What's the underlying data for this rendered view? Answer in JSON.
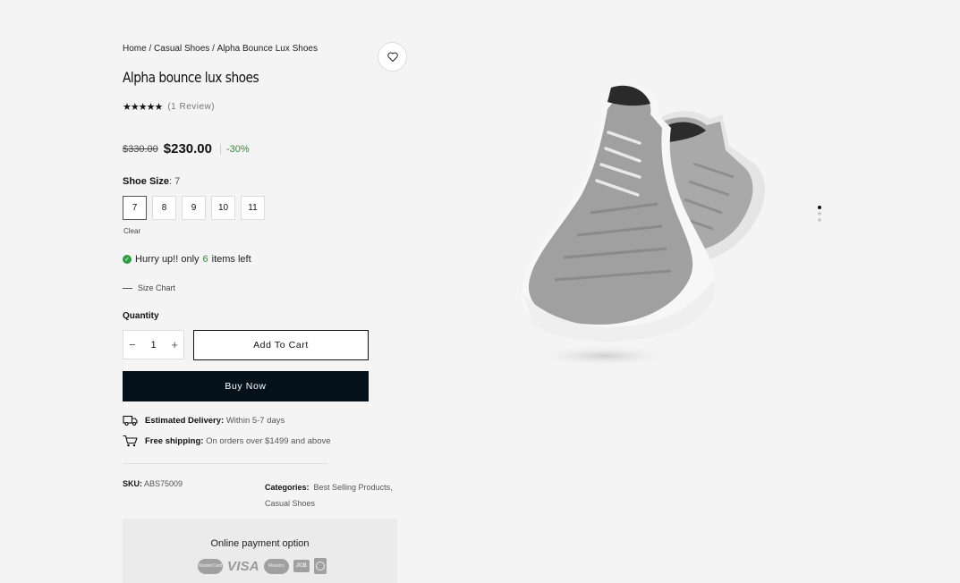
{
  "breadcrumb": {
    "home": "Home",
    "sep1": " / ",
    "category": "Casual Shoes",
    "sep2": " / ",
    "current": "Alpha Bounce Lux Shoes"
  },
  "product": {
    "title": "Alpha bounce lux shoes",
    "stars": "★★★★★",
    "reviews": "(1 Review)",
    "rating_value": 5,
    "old_price": "$330.00",
    "new_price": "$230.00",
    "discount": "-30%"
  },
  "size": {
    "label": "Shoe Size",
    "selected_text": ": 7",
    "options": [
      "7",
      "8",
      "9",
      "10",
      "11"
    ],
    "clear": "Clear"
  },
  "stock": {
    "prefix": "Hurry up!! only",
    "count": "6",
    "suffix": "items left"
  },
  "size_chart": "Size Chart",
  "quantity": {
    "label": "Quantity",
    "value": "1",
    "minus": "−",
    "plus": "+"
  },
  "buttons": {
    "add_to_cart": "Add To Cart",
    "buy_now": "Buy Now"
  },
  "delivery": {
    "label": "Estimated Delivery:",
    "value": "Within 5-7 days"
  },
  "shipping": {
    "label": "Free shipping:",
    "value": "On orders over $1499 and above"
  },
  "meta": {
    "sku_label": "SKU:",
    "sku_value": "ABS75009",
    "categories_label": "Categories:",
    "category_1": "Best Selling Products",
    "comma": ",",
    "category_2": "Casual Shoes"
  },
  "payment": {
    "title": "Online payment option",
    "icons": [
      "mastercard-icon",
      "visa-icon",
      "maestro-icon",
      "jcb-icon",
      "payment-icon"
    ],
    "mastercard": "MasterCard",
    "visa": "VISA",
    "maestro": "Maestro",
    "jcb": "JCB"
  },
  "gallery": {
    "slides": 3,
    "active_slide": 1
  }
}
